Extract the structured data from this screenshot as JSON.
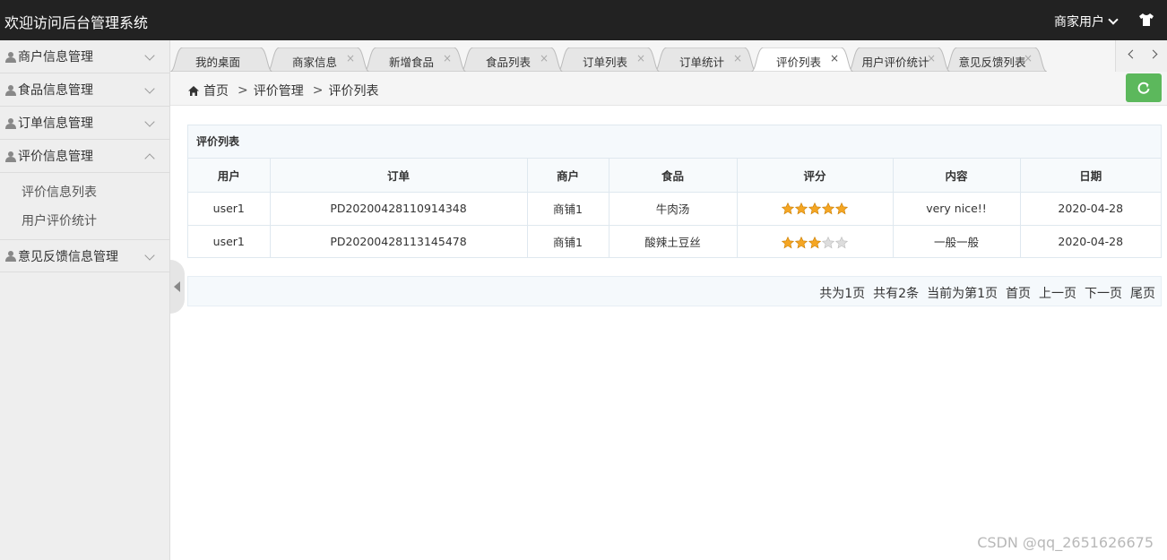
{
  "header": {
    "title": "欢迎访问后台管理系统",
    "user_label": "商家用户",
    "user_dropdown_icon": "chevron-down-icon",
    "skin_icon": "tshirt-icon"
  },
  "sidebar": {
    "items": [
      {
        "label": "商户信息管理",
        "expanded": false
      },
      {
        "label": "食品信息管理",
        "expanded": false
      },
      {
        "label": "订单信息管理",
        "expanded": false
      },
      {
        "label": "评价信息管理",
        "expanded": true
      },
      {
        "label": "意见反馈信息管理",
        "expanded": false
      }
    ],
    "submenu": [
      "评价信息列表",
      "用户评价统计"
    ]
  },
  "tabs": [
    {
      "label": "我的桌面",
      "closable": false,
      "active": false
    },
    {
      "label": "商家信息",
      "closable": true,
      "active": false
    },
    {
      "label": "新增食品",
      "closable": true,
      "active": false
    },
    {
      "label": "食品列表",
      "closable": true,
      "active": false
    },
    {
      "label": "订单列表",
      "closable": true,
      "active": false
    },
    {
      "label": "订单统计",
      "closable": true,
      "active": false
    },
    {
      "label": "评价列表",
      "closable": true,
      "active": true
    },
    {
      "label": "用户评价统计",
      "closable": true,
      "active": false
    },
    {
      "label": "意见反馈列表",
      "closable": true,
      "active": false
    }
  ],
  "tab_close_glyph": "×",
  "breadcrumb": {
    "home": "首页",
    "sep1": ">",
    "level1": "评价管理",
    "sep2": ">",
    "level2": "评价列表"
  },
  "panel": {
    "title": "评价列表",
    "columns": [
      "用户",
      "订单",
      "商户",
      "食品",
      "评分",
      "内容",
      "日期"
    ],
    "rows": [
      {
        "user": "user1",
        "order": "PD20200428110914348",
        "merchant": "商铺1",
        "food": "牛肉汤",
        "rating": 5,
        "content": "very nice!!",
        "date": "2020-04-28"
      },
      {
        "user": "user1",
        "order": "PD20200428113145478",
        "merchant": "商铺1",
        "food": "酸辣土豆丝",
        "rating": 3,
        "content": "一般一般",
        "date": "2020-04-28"
      }
    ],
    "rating_max": 5
  },
  "pager": {
    "total_pages": "共为1页",
    "total_items": "共有2条",
    "current": "当前为第1页",
    "first": "首页",
    "prev": "上一页",
    "next": "下一页",
    "last": "尾页"
  },
  "watermark": "CSDN @qq_2651626675",
  "colors": {
    "header_bg": "#222222",
    "refresh_button": "#5cb85c",
    "star_filled": "#f5a623",
    "star_empty": "#dddddd"
  }
}
